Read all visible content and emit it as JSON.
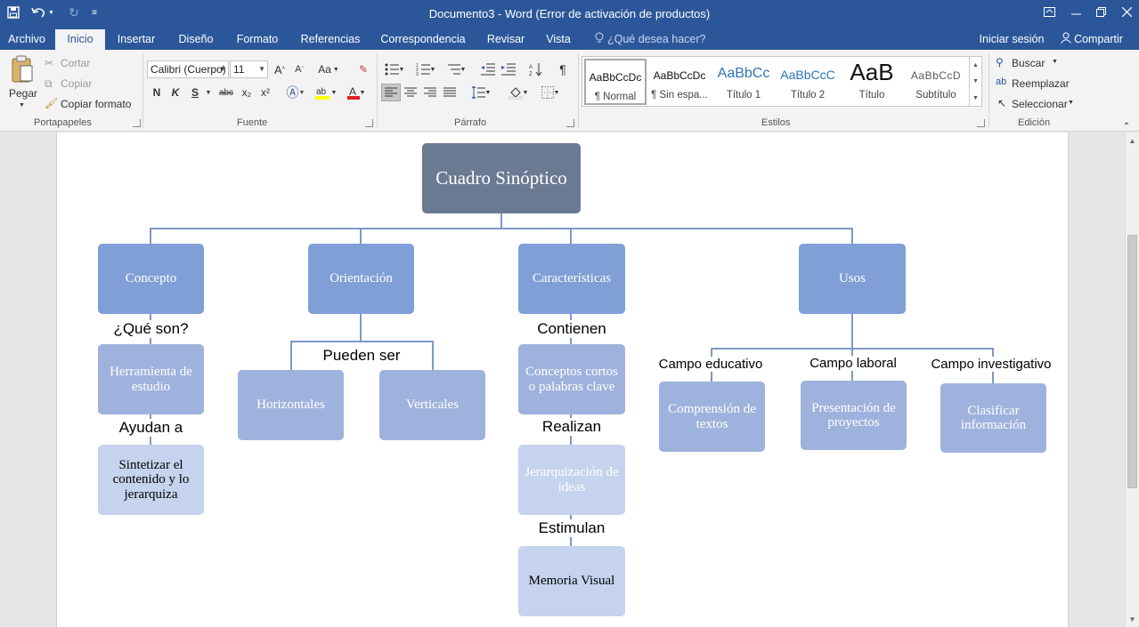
{
  "app": {
    "title": "Documento3 - Word (Error de activación de productos)"
  },
  "quick_access": [
    "save-icon",
    "undo-icon",
    "redo-icon",
    "customize-icon"
  ],
  "window_controls": [
    "ribbon-display-icon",
    "minimize-icon",
    "restore-icon",
    "close-icon"
  ],
  "tabs": [
    {
      "label": "Archivo",
      "active": false
    },
    {
      "label": "Inicio",
      "active": true
    },
    {
      "label": "Insertar",
      "active": false
    },
    {
      "label": "Diseño",
      "active": false
    },
    {
      "label": "Formato",
      "active": false
    },
    {
      "label": "Referencias",
      "active": false
    },
    {
      "label": "Correspondencia",
      "active": false
    },
    {
      "label": "Revisar",
      "active": false
    },
    {
      "label": "Vista",
      "active": false
    }
  ],
  "tell_me": "¿Qué desea hacer?",
  "account": {
    "signin": "Iniciar sesión",
    "share": "Compartir"
  },
  "ribbon": {
    "clipboard": {
      "paste": "Pegar",
      "cut": "Cortar",
      "copy": "Copiar",
      "format_painter": "Copiar formato",
      "group": "Portapapeles"
    },
    "font": {
      "font_name": "Calibri (Cuerpo)",
      "font_size": "11",
      "grow": "A",
      "shrink": "A",
      "change_case": "Aa",
      "bold": "N",
      "italic": "K",
      "underline": "S",
      "strike": "abc",
      "subscript": "x₂",
      "superscript": "x²",
      "group": "Fuente"
    },
    "paragraph": {
      "group": "Párrafo",
      "pilcrow": "¶"
    },
    "styles": {
      "items": [
        {
          "preview": "AaBbCcDc",
          "name": "¶ Normal",
          "color": "#111111"
        },
        {
          "preview": "AaBbCcDc",
          "name": "¶ Sin espa...",
          "color": "#111111"
        },
        {
          "preview": "AaBbCc",
          "name": "Título 1",
          "color": "#2e74b5"
        },
        {
          "preview": "AaBbCcC",
          "name": "Título 2",
          "color": "#2e74b5"
        },
        {
          "preview": "AaB",
          "name": "Título",
          "color": "#111111"
        },
        {
          "preview": "AaBbCcD",
          "name": "Subtítulo",
          "color": "#5a5a5a"
        }
      ],
      "group": "Estilos"
    },
    "editing": {
      "find": "Buscar",
      "replace": "Reemplazar",
      "select": "Seleccionar",
      "group": "Edición"
    }
  },
  "diagram": {
    "title": "Cuadro Sinóptico",
    "branches": {
      "concepto": {
        "label": "Concepto",
        "q1": "¿Qué son?",
        "n1": "Herramienta de estudio",
        "q2": "Ayudan a",
        "n2": "Sintetizar el contenido y lo jerarquiza"
      },
      "orientacion": {
        "label": "Orientación",
        "q1": "Pueden ser",
        "n1": "Horizontales",
        "n2": "Verticales"
      },
      "caracteristicas": {
        "label": "Características",
        "q1": "Contienen",
        "n1": "Conceptos cortos o palabras clave",
        "q2": "Realizan",
        "n2": "Jerarquización de ideas",
        "q3": "Estimulan",
        "n3": "Memoria Visual"
      },
      "usos": {
        "label": "Usos",
        "c1": "Campo educativo",
        "n1": "Comprensión de textos",
        "c2": "Campo laboral",
        "n2": "Presentación de proyectos",
        "c3": "Campo investigativo",
        "n3": "Clasificar información"
      }
    },
    "colors": {
      "root": "#6b7a93",
      "level1": "#7f9fd6",
      "level2": "#9fb2dd",
      "level3": "#c5d3ee",
      "connector": "#7e98c5"
    }
  }
}
